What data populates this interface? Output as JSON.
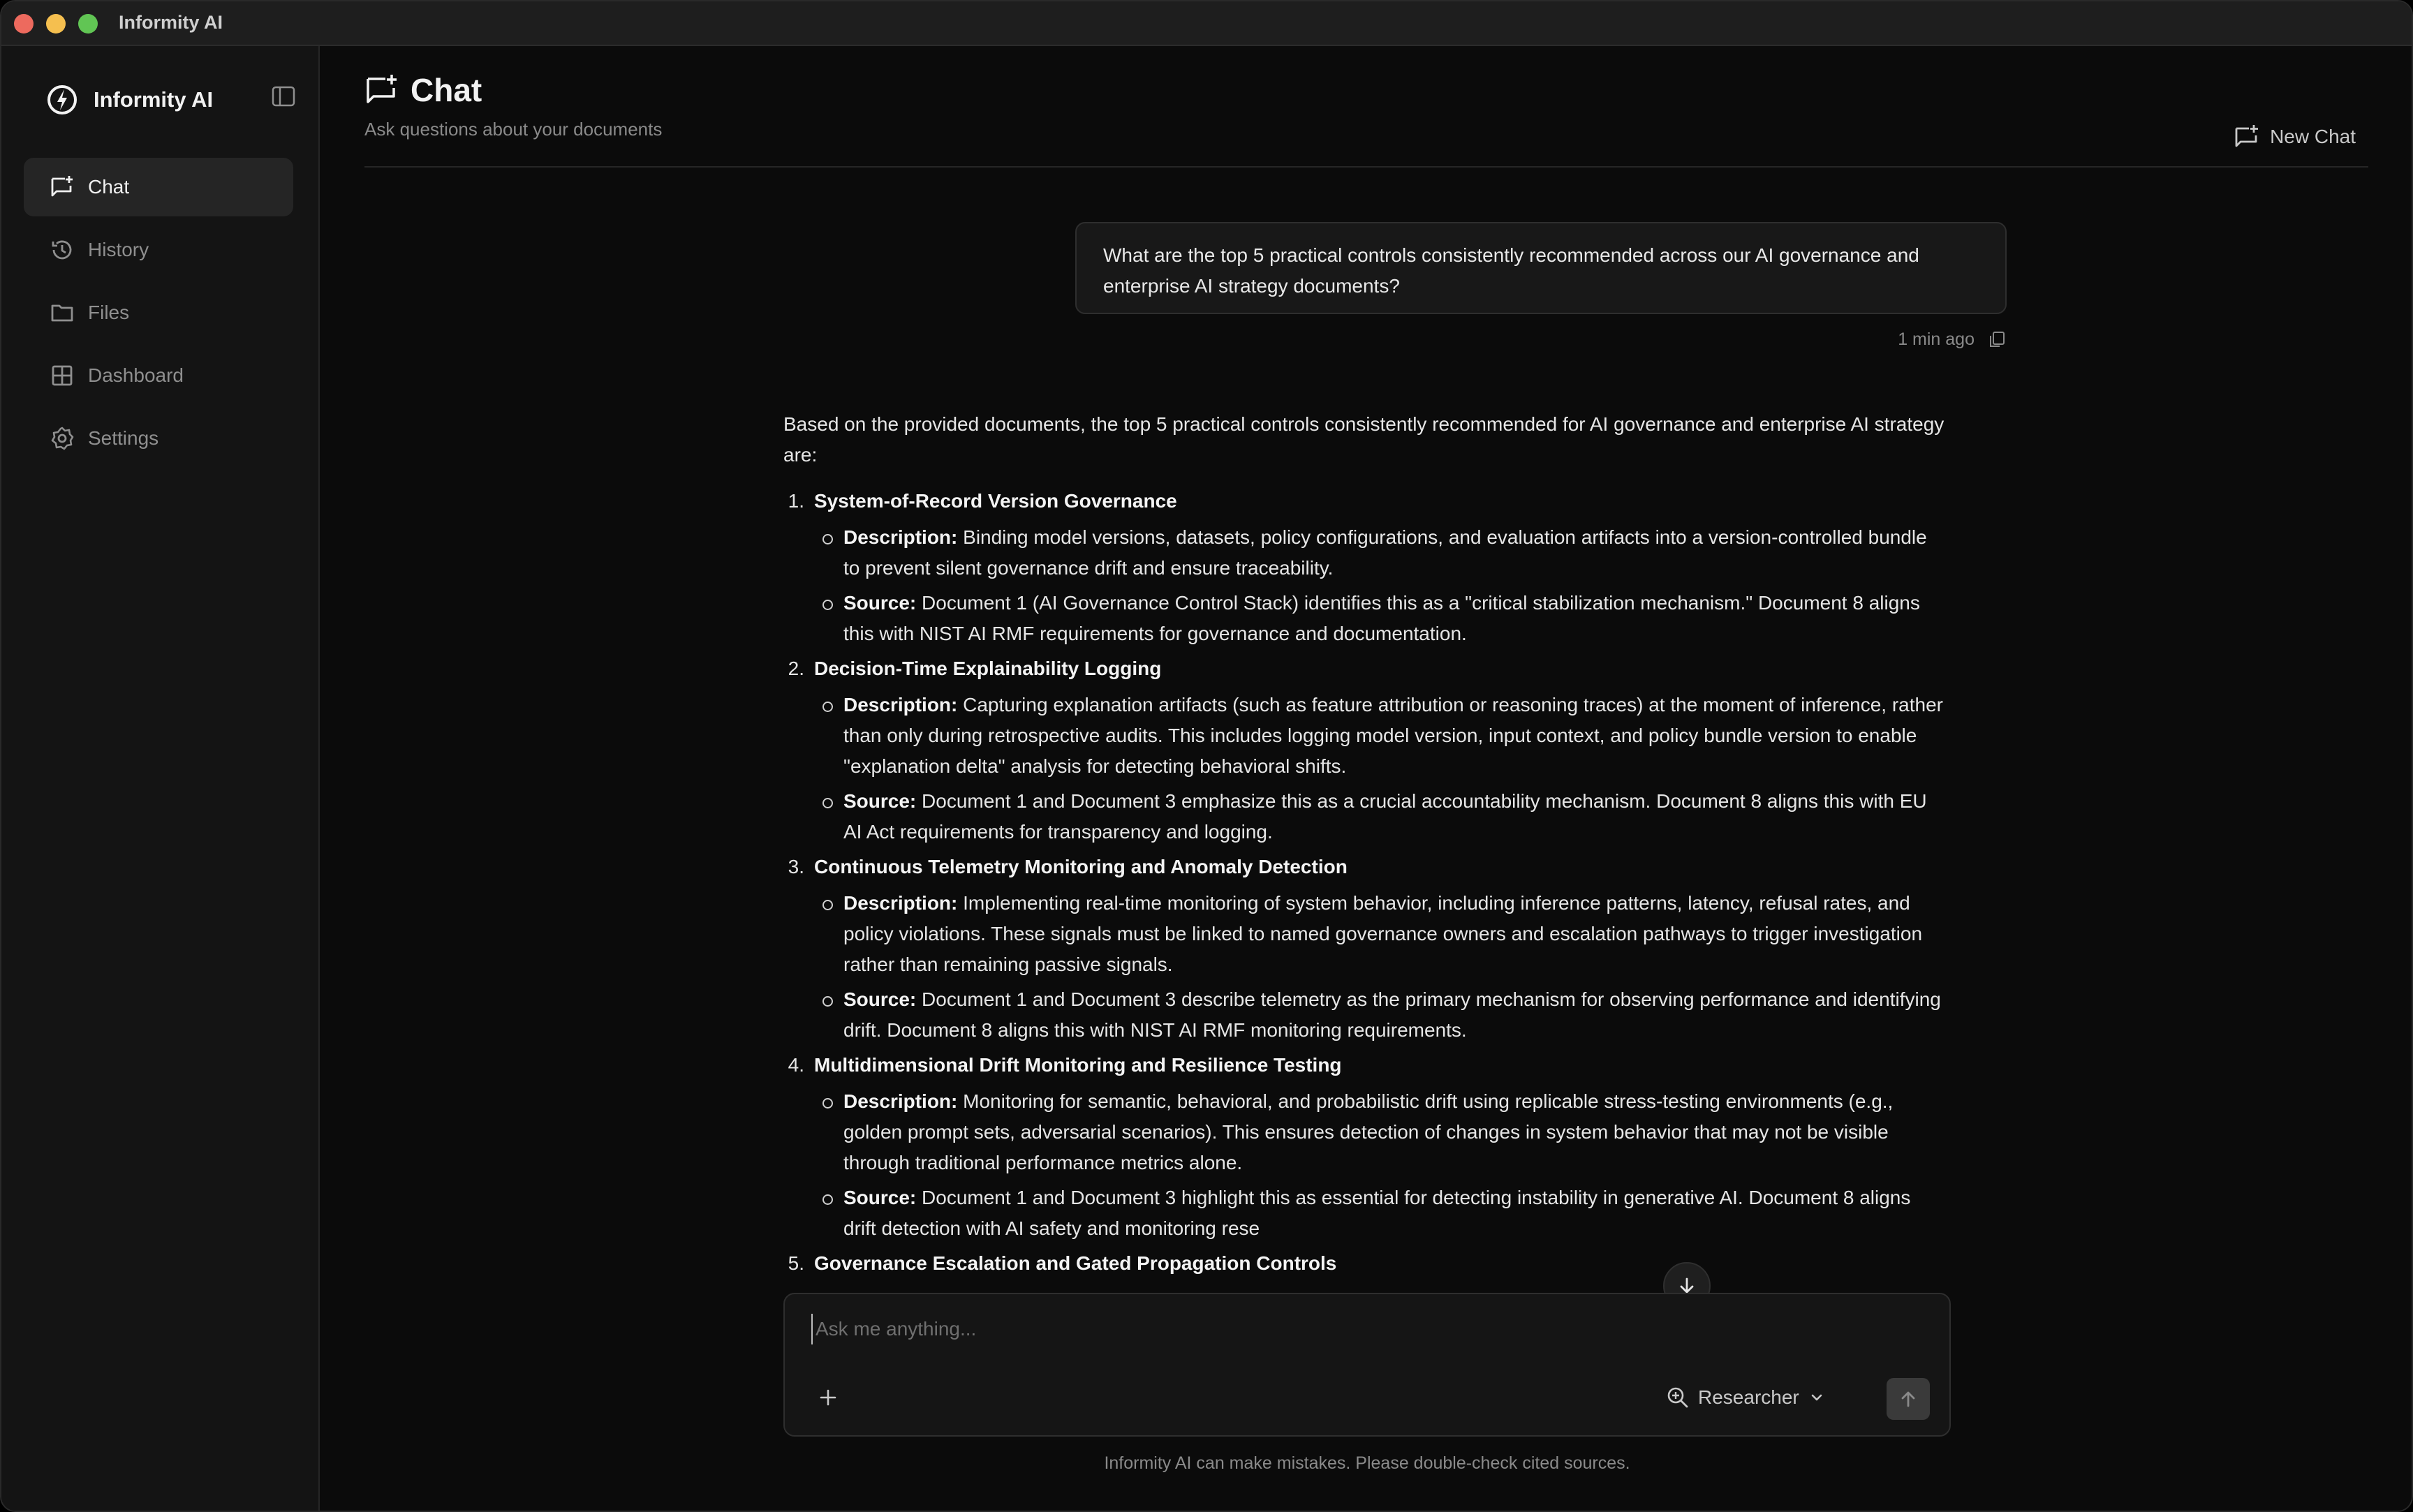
{
  "window": {
    "title": "Informity AI"
  },
  "sidebar": {
    "brand": "Informity AI",
    "items": [
      {
        "label": "Chat",
        "icon": "chat-plus-icon",
        "active": true
      },
      {
        "label": "History",
        "icon": "history-icon",
        "active": false
      },
      {
        "label": "Files",
        "icon": "folder-icon",
        "active": false
      },
      {
        "label": "Dashboard",
        "icon": "dashboard-grid-icon",
        "active": false
      },
      {
        "label": "Settings",
        "icon": "gear-icon",
        "active": false
      }
    ]
  },
  "header": {
    "title": "Chat",
    "subtitle": "Ask questions about your documents",
    "new_chat_label": "New Chat"
  },
  "conversation": {
    "user_message": "What are the top 5 practical controls consistently recommended across our AI governance and enterprise AI strategy documents?",
    "user_timestamp": "1 min ago",
    "answer_intro": "Based on the provided documents, the top 5 practical controls consistently recommended for AI governance and enterprise AI strategy are:",
    "description_label": "Description:",
    "source_label": "Source:",
    "items": [
      {
        "num": "1.",
        "title": "System-of-Record Version Governance",
        "description": "Binding model versions, datasets, policy configurations, and evaluation artifacts into a version-controlled bundle to prevent silent governance drift and ensure traceability.",
        "source": "Document 1 (AI Governance Control Stack) identifies this as a \"critical stabilization mechanism.\" Document 8 aligns this with NIST AI RMF requirements for governance and documentation."
      },
      {
        "num": "2.",
        "title": "Decision-Time Explainability Logging",
        "description": "Capturing explanation artifacts (such as feature attribution or reasoning traces) at the moment of inference, rather than only during retrospective audits. This includes logging model version, input context, and policy bundle version to enable \"explanation delta\" analysis for detecting behavioral shifts.",
        "source": "Document 1 and Document 3 emphasize this as a crucial accountability mechanism. Document 8 aligns this with EU AI Act requirements for transparency and logging."
      },
      {
        "num": "3.",
        "title": "Continuous Telemetry Monitoring and Anomaly Detection",
        "description": "Implementing real-time monitoring of system behavior, including inference patterns, latency, refusal rates, and policy violations. These signals must be linked to named governance owners and escalation pathways to trigger investigation rather than remaining passive signals.",
        "source": "Document 1 and Document 3 describe telemetry as the primary mechanism for observing performance and identifying drift. Document 8 aligns this with NIST AI RMF monitoring requirements."
      },
      {
        "num": "4.",
        "title": "Multidimensional Drift Monitoring and Resilience Testing",
        "description": "Monitoring for semantic, behavioral, and probabilistic drift using replicable stress-testing environments (e.g., golden prompt sets, adversarial scenarios). This ensures detection of changes in system behavior that may not be visible through traditional performance metrics alone.",
        "source": "Document 1 and Document 3 highlight this as essential for detecting instability in generative AI. Document 8 aligns drift detection with AI safety and monitoring rese"
      },
      {
        "num": "5.",
        "title": "Governance Escalation and Gated Propagation Controls",
        "description": "",
        "source": ""
      }
    ]
  },
  "composer": {
    "placeholder": "Ask me anything...",
    "mode_label": "Researcher",
    "disclaimer": "Informity AI can make mistakes. Please double-check cited sources."
  }
}
